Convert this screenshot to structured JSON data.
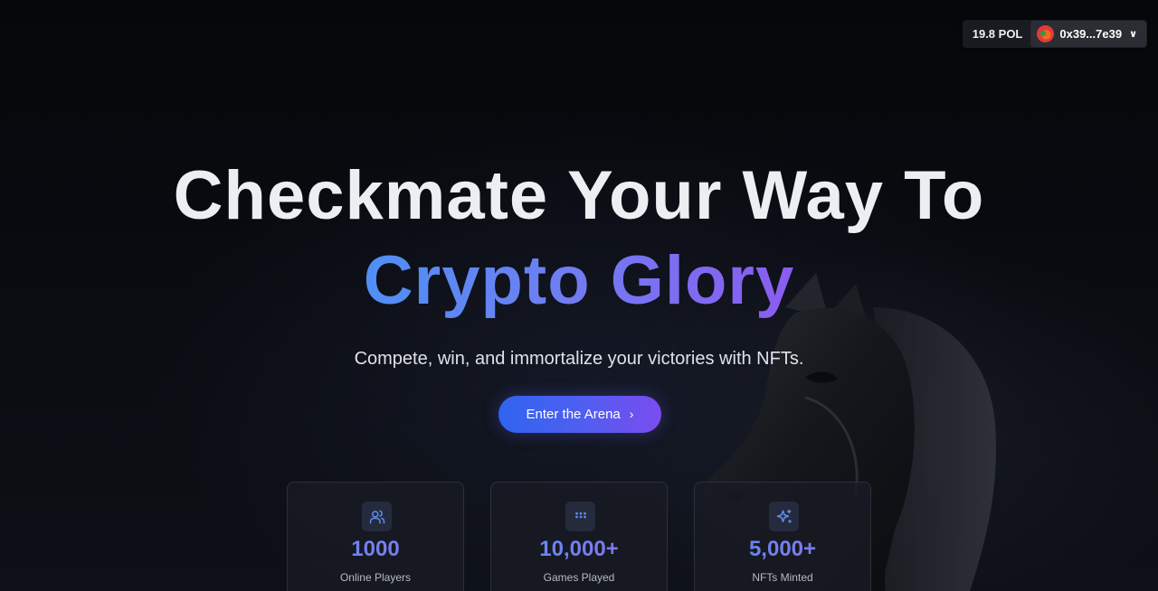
{
  "wallet": {
    "balance": "19.8 POL",
    "address": "0x39...7e39",
    "chevron": "❯"
  },
  "hero": {
    "title_line1": "Checkmate Your Way To",
    "title_line2": "Crypto Glory",
    "subtitle": "Compete, win, and immortalize your victories with NFTs.",
    "cta_label": "Enter the Arena",
    "cta_arrow": "›"
  },
  "stats": [
    {
      "icon": "users-icon",
      "value": "1000",
      "label": "Online Players"
    },
    {
      "icon": "grid-dots-icon",
      "value": "10,000+",
      "label": "Games Played"
    },
    {
      "icon": "sparkles-icon",
      "value": "5,000+",
      "label": "NFTs Minted"
    }
  ],
  "colors": {
    "background": "#07080c",
    "accent_blue": "#4f8ff5",
    "accent_purple": "#8a5cf0",
    "stat_icon": "#5b8ff2"
  }
}
